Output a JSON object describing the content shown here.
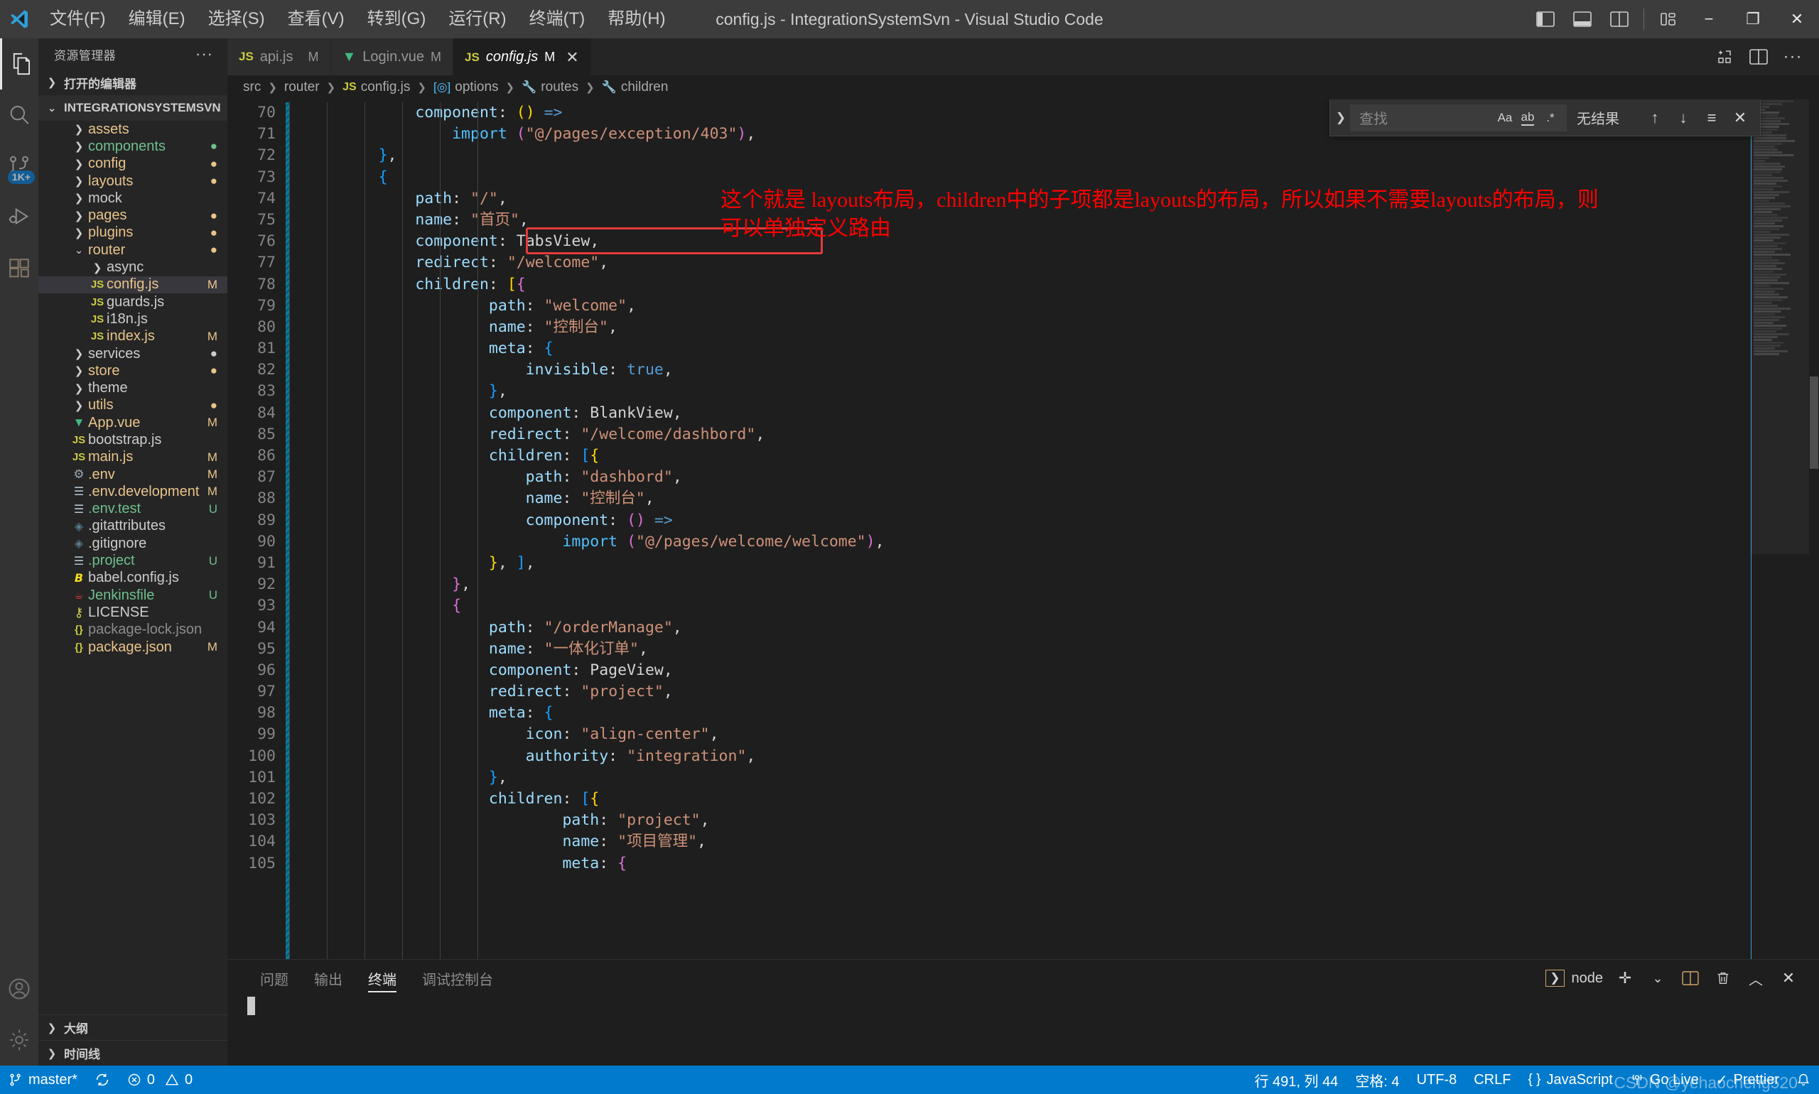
{
  "window": {
    "title": "config.js - IntegrationSystemSvn - Visual Studio Code",
    "menus": [
      "文件(F)",
      "编辑(E)",
      "选择(S)",
      "查看(V)",
      "转到(G)",
      "运行(R)",
      "终端(T)",
      "帮助(H)"
    ],
    "controls": {
      "toggle_primary_sidebar": "toggle-primary-sidebar-icon",
      "toggle_panel": "toggle-panel-icon",
      "toggle_secondary_sidebar": "toggle-secondary-sidebar-icon",
      "customize_layout": "customize-layout-icon",
      "minimize": "−",
      "maximize": "❐",
      "close": "✕"
    }
  },
  "activitybar": {
    "items": [
      {
        "name": "explorer",
        "icon": "files-icon",
        "active": true,
        "badge": ""
      },
      {
        "name": "search",
        "icon": "search-icon",
        "active": false,
        "badge": ""
      },
      {
        "name": "source-control",
        "icon": "source-control-icon",
        "active": false,
        "badge": "1K+"
      },
      {
        "name": "run-and-debug",
        "icon": "debug-icon",
        "active": false,
        "badge": ""
      },
      {
        "name": "extensions",
        "icon": "extensions-icon",
        "active": false,
        "badge": ""
      }
    ],
    "bottom": [
      {
        "name": "accounts",
        "icon": "account-icon"
      },
      {
        "name": "settings",
        "icon": "gear-icon"
      }
    ]
  },
  "sidebar": {
    "title": "资源管理器",
    "more_actions": "···",
    "open_editors_label": "打开的编辑器",
    "project_label": "INTEGRATIONSYSTEMSVN",
    "outline_label": "大纲",
    "timeline_label": "时间线",
    "tree": [
      {
        "label": "assets",
        "type": "folder",
        "depth": 1,
        "open": false,
        "color": "#e8c48a",
        "mod": ""
      },
      {
        "label": "components",
        "type": "folder",
        "depth": 1,
        "open": false,
        "color": "#6ec08a",
        "mod": "●"
      },
      {
        "label": "config",
        "type": "folder",
        "depth": 1,
        "open": false,
        "color": "#e8c48a",
        "mod": "●"
      },
      {
        "label": "layouts",
        "type": "folder",
        "depth": 1,
        "open": false,
        "color": "#e8c48a",
        "mod": "●"
      },
      {
        "label": "mock",
        "type": "folder",
        "depth": 1,
        "open": false,
        "color": "#cccccc",
        "mod": ""
      },
      {
        "label": "pages",
        "type": "folder",
        "depth": 1,
        "open": false,
        "color": "#e8c48a",
        "mod": "●"
      },
      {
        "label": "plugins",
        "type": "folder",
        "depth": 1,
        "open": false,
        "color": "#e8c48a",
        "mod": "●"
      },
      {
        "label": "router",
        "type": "folder",
        "depth": 1,
        "open": true,
        "color": "#e8c48a",
        "mod": "●"
      },
      {
        "label": "async",
        "type": "folder",
        "depth": 2,
        "open": false,
        "color": "#cccccc",
        "mod": ""
      },
      {
        "label": "config.js",
        "type": "js",
        "depth": 2,
        "selected": true,
        "color": "#e8c48a",
        "mod": "M"
      },
      {
        "label": "guards.js",
        "type": "js",
        "depth": 2,
        "color": "#cccccc",
        "mod": ""
      },
      {
        "label": "i18n.js",
        "type": "js",
        "depth": 2,
        "color": "#cccccc",
        "mod": ""
      },
      {
        "label": "index.js",
        "type": "js",
        "depth": 2,
        "color": "#e8c48a",
        "mod": "M"
      },
      {
        "label": "services",
        "type": "folder",
        "depth": 1,
        "open": false,
        "color": "#cccccc",
        "mod": "●"
      },
      {
        "label": "store",
        "type": "folder",
        "depth": 1,
        "open": false,
        "color": "#e8c48a",
        "mod": "●"
      },
      {
        "label": "theme",
        "type": "folder",
        "depth": 1,
        "open": false,
        "color": "#cccccc",
        "mod": ""
      },
      {
        "label": "utils",
        "type": "folder",
        "depth": 1,
        "open": false,
        "color": "#e8c48a",
        "mod": "●"
      },
      {
        "label": "App.vue",
        "type": "vue",
        "depth": 1,
        "color": "#e8c48a",
        "mod": "M"
      },
      {
        "label": "bootstrap.js",
        "type": "js",
        "depth": 1,
        "color": "#cccccc",
        "mod": ""
      },
      {
        "label": "main.js",
        "type": "js",
        "depth": 1,
        "color": "#e8c48a",
        "mod": "M"
      },
      {
        "label": ".env",
        "type": "gear",
        "depth": 1,
        "color": "#e8c48a",
        "mod": "M"
      },
      {
        "label": ".env.development",
        "type": "text",
        "depth": 1,
        "color": "#e8c48a",
        "mod": "M"
      },
      {
        "label": ".env.test",
        "type": "text",
        "depth": 1,
        "color": "#6ec08a",
        "mod": "U"
      },
      {
        "label": ".gitattributes",
        "type": "git",
        "depth": 1,
        "color": "#cccccc",
        "mod": ""
      },
      {
        "label": ".gitignore",
        "type": "git",
        "depth": 1,
        "color": "#cccccc",
        "mod": ""
      },
      {
        "label": ".project",
        "type": "text",
        "depth": 1,
        "color": "#6ec08a",
        "mod": "U"
      },
      {
        "label": "babel.config.js",
        "type": "babel",
        "depth": 1,
        "color": "#cccccc",
        "mod": ""
      },
      {
        "label": "Jenkinsfile",
        "type": "jenkins",
        "depth": 1,
        "color": "#6ec08a",
        "mod": "U"
      },
      {
        "label": "LICENSE",
        "type": "key",
        "depth": 1,
        "color": "#cccccc",
        "mod": ""
      },
      {
        "label": "package-lock.json",
        "type": "json",
        "depth": 1,
        "color": "#8c8c8c",
        "mod": ""
      },
      {
        "label": "package.json",
        "type": "json",
        "depth": 1,
        "color": "#e8c48a",
        "mod": "M"
      }
    ]
  },
  "editor": {
    "tabs": [
      {
        "name": "api.js",
        "icon": "js-icon",
        "mod": "M",
        "active": false
      },
      {
        "name": "Login.vue",
        "icon": "vue-icon",
        "mod": "M",
        "active": false
      },
      {
        "name": "config.js",
        "icon": "js-icon",
        "mod": "M",
        "active": true
      }
    ],
    "tab_actions": [
      "split-editor-icon",
      "more-actions-icon"
    ],
    "breadcrumb": [
      {
        "label": "src",
        "icon": ""
      },
      {
        "label": "router",
        "icon": ""
      },
      {
        "label": "config.js",
        "icon": "js-icon"
      },
      {
        "label": "options",
        "icon": "object-icon"
      },
      {
        "label": "routes",
        "icon": "property-icon"
      },
      {
        "label": "children",
        "icon": "property-icon"
      }
    ],
    "first_line": 70,
    "annotation": "这个就是 layouts布局，children中的子项都是layouts的布局，所以如果不需要layouts的布局，则可以单独定义路由",
    "highlight_line": 76,
    "find": {
      "placeholder": "查找",
      "value": "",
      "match_case_label": "Aa",
      "whole_word_label": "ab",
      "regex_label": ".*",
      "status": "无结果",
      "prev": "↑",
      "next": "↓",
      "in_selection": "≡",
      "close": "✕",
      "expand": "❯"
    },
    "code_lines": [
      {
        "n": 70,
        "html": "            <span class='p'>component</span><span class='d'>:</span> <span class='y'>(</span><span class='y'>)</span> <span class='k'>=&gt;</span>"
      },
      {
        "n": 71,
        "html": "                <span class='i'>import</span> <span class='v'>(</span><span class='s'>\"@/pages/exception/403\"</span><span class='v'>)</span><span class='d'>,</span>"
      },
      {
        "n": 72,
        "html": "        <span class='b'>}</span><span class='d'>,</span>"
      },
      {
        "n": 73,
        "html": "        <span class='b'>{</span>"
      },
      {
        "n": 74,
        "html": "            <span class='p'>path</span><span class='d'>:</span> <span class='s'>\"/\"</span><span class='d'>,</span>"
      },
      {
        "n": 75,
        "html": "            <span class='p'>name</span><span class='d'>:</span> <span class='s'>\"首页\"</span><span class='d'>,</span>"
      },
      {
        "n": 76,
        "html": "            <span class='p'>component</span><span class='d'>:</span> <span class='d'>TabsView</span><span class='d'>,</span>"
      },
      {
        "n": 77,
        "html": "            <span class='p'>redirect</span><span class='d'>:</span> <span class='s'>\"/welcome\"</span><span class='d'>,</span>"
      },
      {
        "n": 78,
        "html": "            <span class='p'>children</span><span class='d'>:</span> <span class='y'>[</span><span class='v'>{</span>"
      },
      {
        "n": 79,
        "html": "                    <span class='p'>path</span><span class='d'>:</span> <span class='s'>\"welcome\"</span><span class='d'>,</span>"
      },
      {
        "n": 80,
        "html": "                    <span class='p'>name</span><span class='d'>:</span> <span class='s'>\"控制台\"</span><span class='d'>,</span>"
      },
      {
        "n": 81,
        "html": "                    <span class='p'>meta</span><span class='d'>:</span> <span class='b'>{</span>"
      },
      {
        "n": 82,
        "html": "                        <span class='p'>invisible</span><span class='d'>:</span> <span class='k'>true</span><span class='d'>,</span>"
      },
      {
        "n": 83,
        "html": "                    <span class='b'>}</span><span class='d'>,</span>"
      },
      {
        "n": 84,
        "html": "                    <span class='p'>component</span><span class='d'>:</span> <span class='d'>BlankView</span><span class='d'>,</span>"
      },
      {
        "n": 85,
        "html": "                    <span class='p'>redirect</span><span class='d'>:</span> <span class='s'>\"/welcome/dashbord\"</span><span class='d'>,</span>"
      },
      {
        "n": 86,
        "html": "                    <span class='p'>children</span><span class='d'>:</span> <span class='b'>[</span><span class='y'>{</span>"
      },
      {
        "n": 87,
        "html": "                        <span class='p'>path</span><span class='d'>:</span> <span class='s'>\"dashbord\"</span><span class='d'>,</span>"
      },
      {
        "n": 88,
        "html": "                        <span class='p'>name</span><span class='d'>:</span> <span class='s'>\"控制台\"</span><span class='d'>,</span>"
      },
      {
        "n": 89,
        "html": "                        <span class='p'>component</span><span class='d'>:</span> <span class='v'>(</span><span class='v'>)</span> <span class='k'>=&gt;</span>"
      },
      {
        "n": 90,
        "html": "                            <span class='i'>import</span> <span class='v'>(</span><span class='s'>\"@/pages/welcome/welcome\"</span><span class='v'>)</span><span class='d'>,</span>"
      },
      {
        "n": 91,
        "html": "                    <span class='y'>}</span><span class='d'>,</span> <span class='b'>]</span><span class='d'>,</span>"
      },
      {
        "n": 92,
        "html": "                <span class='v'>}</span><span class='d'>,</span>"
      },
      {
        "n": 93,
        "html": "                <span class='v'>{</span>"
      },
      {
        "n": 94,
        "html": "                    <span class='p'>path</span><span class='d'>:</span> <span class='s'>\"/orderManage\"</span><span class='d'>,</span>"
      },
      {
        "n": 95,
        "html": "                    <span class='p'>name</span><span class='d'>:</span> <span class='s'>\"一体化订单\"</span><span class='d'>,</span>"
      },
      {
        "n": 96,
        "html": "                    <span class='p'>component</span><span class='d'>:</span> <span class='d'>PageView</span><span class='d'>,</span>"
      },
      {
        "n": 97,
        "html": "                    <span class='p'>redirect</span><span class='d'>:</span> <span class='s'>\"project\"</span><span class='d'>,</span>"
      },
      {
        "n": 98,
        "html": "                    <span class='p'>meta</span><span class='d'>:</span> <span class='b'>{</span>"
      },
      {
        "n": 99,
        "html": "                        <span class='p'>icon</span><span class='d'>:</span> <span class='s'>\"align-center\"</span><span class='d'>,</span>"
      },
      {
        "n": 100,
        "html": "                        <span class='p'>authority</span><span class='d'>:</span> <span class='s'>\"integration\"</span><span class='d'>,</span>"
      },
      {
        "n": 101,
        "html": "                    <span class='b'>}</span><span class='d'>,</span>"
      },
      {
        "n": 102,
        "html": "                    <span class='p'>children</span><span class='d'>:</span> <span class='b'>[</span><span class='y'>{</span>"
      },
      {
        "n": 103,
        "html": "                            <span class='p'>path</span><span class='d'>:</span> <span class='s'>\"project\"</span><span class='d'>,</span>"
      },
      {
        "n": 104,
        "html": "                            <span class='p'>name</span><span class='d'>:</span> <span class='s'>\"项目管理\"</span><span class='d'>,</span>"
      },
      {
        "n": 105,
        "html": "                            <span class='p'>meta</span><span class='d'>:</span> <span class='v'>{</span>"
      }
    ]
  },
  "panel": {
    "tabs": [
      {
        "label": "问题",
        "active": false
      },
      {
        "label": "输出",
        "active": false
      },
      {
        "label": "终端",
        "active": true
      },
      {
        "label": "调试控制台",
        "active": false
      }
    ],
    "terminal_name": "node",
    "actions": [
      "new-terminal-icon",
      "terminal-dropdown-icon",
      "split-terminal-icon",
      "kill-terminal-icon",
      "maximize-panel-icon",
      "close-panel-icon"
    ]
  },
  "statusbar": {
    "branch": "master*",
    "sync_icon": "sync-icon",
    "errors": "0",
    "warnings": "0",
    "cursor": "行 491, 列 44",
    "indent": "空格: 4",
    "encoding": "UTF-8",
    "eol": "CRLF",
    "language": "JavaScript",
    "golive": "Go Live",
    "prettier": "Prettier",
    "bell": "notifications-icon",
    "watermark": "CSDN @yehaocheng520"
  }
}
